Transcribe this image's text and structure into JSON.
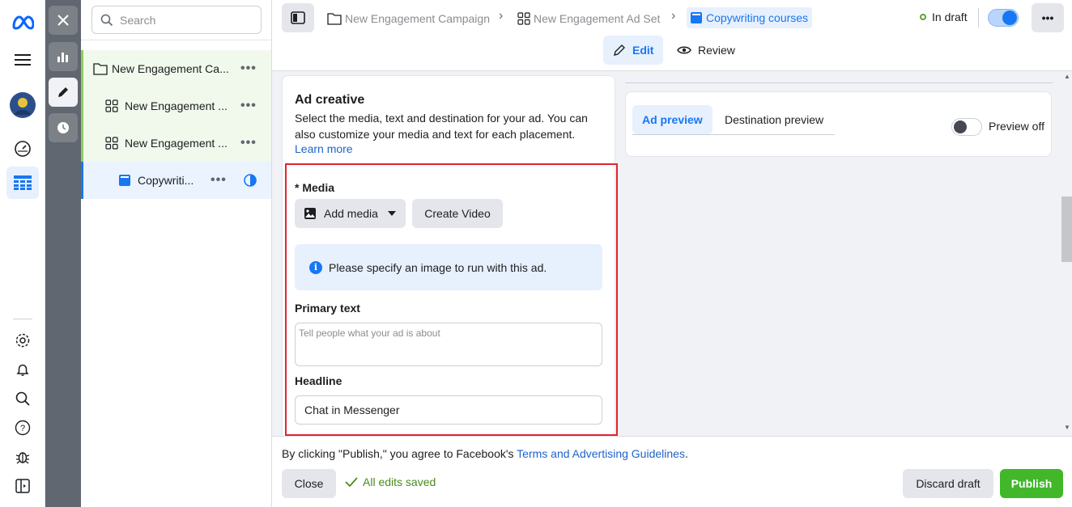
{
  "rail": {
    "icons": [
      "meta-logo-icon",
      "menu-icon",
      "avatar",
      "dashboard-icon",
      "table-grid-icon",
      "settings-icon",
      "bell-icon",
      "search-icon",
      "help-icon",
      "bug-icon",
      "sidebar-panel-icon"
    ]
  },
  "tools": {
    "icons": [
      "close-icon",
      "bar-chart-icon",
      "pencil-icon",
      "clock-icon"
    ]
  },
  "tree": {
    "search_placeholder": "Search",
    "items": [
      {
        "label": "New Engagement Ca...",
        "icon": "folder-icon"
      },
      {
        "label": "New Engagement ...",
        "icon": "grid-icon"
      },
      {
        "label": "New Engagement ...",
        "icon": "grid-icon"
      },
      {
        "label": "Copywriti...",
        "icon": "ad-icon"
      }
    ],
    "more": "•••"
  },
  "topbar": {
    "breadcrumb": [
      "New Engagement Campaign",
      "New Engagement Ad Set",
      "Copywriting courses"
    ],
    "status": "In draft",
    "tabs": {
      "edit": "Edit",
      "review": "Review"
    },
    "more": "•••"
  },
  "creative": {
    "title": "Ad creative",
    "description": "Select the media, text and destination for your ad. You can also customize your media and text for each placement.",
    "learn_more": "Learn more",
    "media_label": "* Media",
    "add_media": "Add media",
    "create_video": "Create Video",
    "info_message": "Please specify an image to run with this ad.",
    "info_icon": "i",
    "primary_text_label": "Primary text",
    "primary_text_placeholder": "Tell people what your ad is about",
    "headline_label": "Headline",
    "headline_value": "Chat in Messenger"
  },
  "preview": {
    "tab_ad": "Ad preview",
    "tab_destination": "Destination preview",
    "toggle_label": "Preview off"
  },
  "footer": {
    "terms_prefix": "By clicking \"Publish,\" you agree to Facebook's ",
    "terms_link": "Terms and Advertising Guidelines",
    "terms_suffix": ".",
    "close": "Close",
    "saved": "All edits saved",
    "discard": "Discard draft",
    "publish": "Publish"
  },
  "colors": {
    "accent": "#1877f2",
    "publish": "#42b72a",
    "highlight": "#e0242f"
  }
}
